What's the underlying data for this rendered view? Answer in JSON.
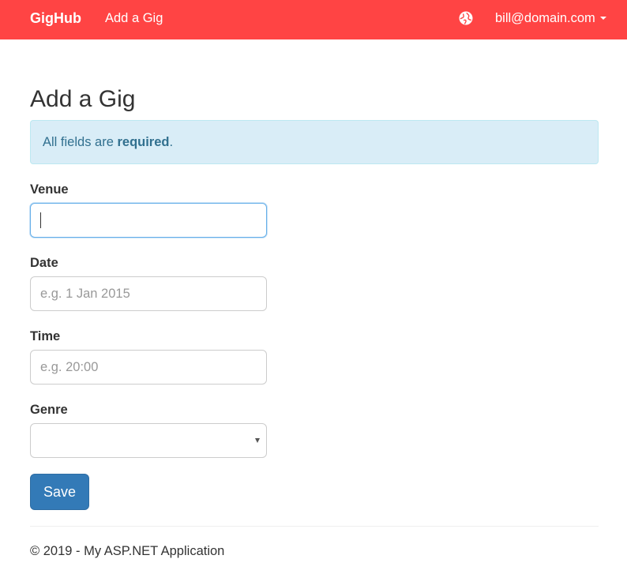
{
  "navbar": {
    "brand": "GigHub",
    "link_add_gig": "Add a Gig",
    "user_menu": "bill@domain.com",
    "background_color": "#ff4444",
    "icons": [
      "globe-icon",
      "caret-down-icon"
    ]
  },
  "page": {
    "title": "Add a Gig"
  },
  "alert": {
    "prefix": "All fields are ",
    "emphasis": "required",
    "suffix": "."
  },
  "form": {
    "venue": {
      "label": "Venue",
      "value": "",
      "placeholder": ""
    },
    "date": {
      "label": "Date",
      "value": "",
      "placeholder": "e.g. 1 Jan 2015"
    },
    "time": {
      "label": "Time",
      "value": "",
      "placeholder": "e.g. 20:00"
    },
    "genre": {
      "label": "Genre",
      "selected": ""
    },
    "save_label": "Save"
  },
  "footer": {
    "text": "© 2019 - My ASP.NET Application"
  }
}
